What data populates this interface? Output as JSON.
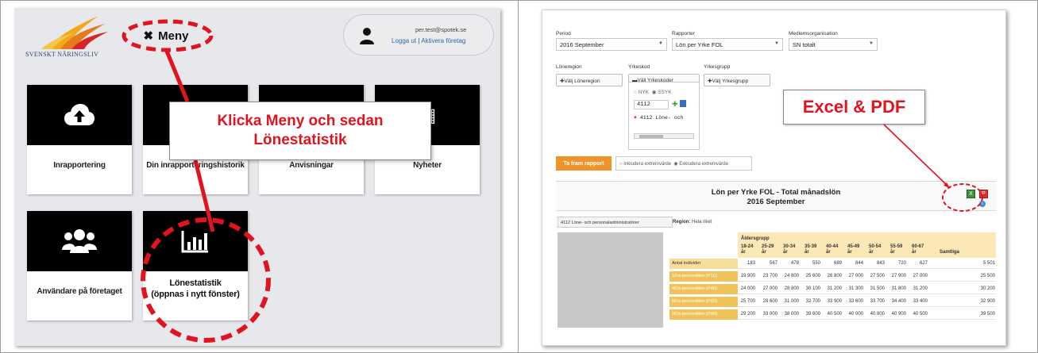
{
  "left_panel": {
    "logo": {
      "text": "SVENSKT NÄRINGSLIV"
    },
    "menu": {
      "icon": "close-icon",
      "label": "Meny"
    },
    "user": {
      "email": "per.test@spotek.se",
      "logout": "Logga ut",
      "separator": "|",
      "change": "Aktivera företag"
    },
    "tiles": [
      {
        "label": "Inrapportering",
        "icon": "cloud-upload-icon"
      },
      {
        "label": "Din inrapporteringshistorik",
        "icon": "history-icon"
      },
      {
        "label": "Anvisningar",
        "icon": "book-icon"
      },
      {
        "label": "Nyheter",
        "icon": "news-icon"
      },
      {
        "label": "Användare på företaget",
        "icon": "users-icon"
      },
      {
        "label_line1": "Lönestatistik",
        "label_line2": "(öppnas i nytt fönster)",
        "icon": "bar-chart-icon"
      }
    ],
    "callout": {
      "line1": "Klicka Meny och sedan",
      "line2": "Lönestatistik"
    },
    "highlight_color": "#e0141e"
  },
  "right_panel": {
    "filters": {
      "period_label": "Period",
      "period_value": "2016 September",
      "rapporter_label": "Rapporter",
      "rapporter_value": "Lön per Yrke FOL",
      "medlem_label": "Medlemsorganisation",
      "medlem_value": "SN totalt",
      "loneregion_label": "Löneregion",
      "loneregion_btn": "✚Välj Löneregion",
      "yrkeskod_label": "Yrkeskod",
      "yrkeskod_btn": "▬Välj Yrkeskoder",
      "yrkesgrupp_label": "Yrkesgrupp",
      "yrkesgrupp_btn": "✚Välj Yrkesgrupp",
      "radio_nyk": "NYK",
      "radio_ssyk": "SSYK",
      "code_value": "4112",
      "selected_item": "4112 Löne- och"
    },
    "callout": "Excel & PDF",
    "run_button": "Ta fram rapport",
    "extreme_include": "Inkludera extremvärde",
    "extreme_exclude": "Exkludera extremvärde",
    "report": {
      "title": "Lön per Yrke FOL - Total månadslön",
      "subtitle": "2016 September",
      "side_label": "4112 Löne- och personaladministratörer",
      "region_label": "Region:",
      "region_value": "Hela riket",
      "age_group_label": "Åldersgrupp",
      "age_groups": [
        "18-24 år",
        "25-29 år",
        "30-34 år",
        "35-39 år",
        "40-44 år",
        "45-49 år",
        "50-54 år",
        "55-59 år",
        "60-67 år",
        "Samtliga"
      ],
      "rows": [
        {
          "label": "Antal individer",
          "values": [
            "183",
            "567",
            "478",
            "550",
            "689",
            "844",
            "843",
            "720",
            "627",
            "5 501"
          ]
        },
        {
          "label": "10:e percentilen (P10)",
          "values": [
            "19 900",
            "23 700",
            "24 800",
            "25 600",
            "26 800",
            "27 000",
            "27 500",
            "27 900",
            "27 000",
            "25 500"
          ]
        },
        {
          "label": "40:e percentilen (P40)",
          "values": [
            "24 000",
            "27 000",
            "28 800",
            "30 100",
            "31 200",
            "31 300",
            "31 500",
            "31 800",
            "31 200",
            "30 200"
          ]
        },
        {
          "label": "60:e percentilen (P60)",
          "values": [
            "25 700",
            "28 600",
            "31 000",
            "32 700",
            "33 900",
            "33 600",
            "33 700",
            "34 400",
            "33 400",
            "32 900"
          ]
        },
        {
          "label": "90:e percentilen (P90)",
          "values": [
            "29 200",
            "33 000",
            "38 000",
            "39 600",
            "40 500",
            "40 000",
            "40 800",
            "40 900",
            "40 500",
            "39 500"
          ]
        }
      ]
    }
  }
}
